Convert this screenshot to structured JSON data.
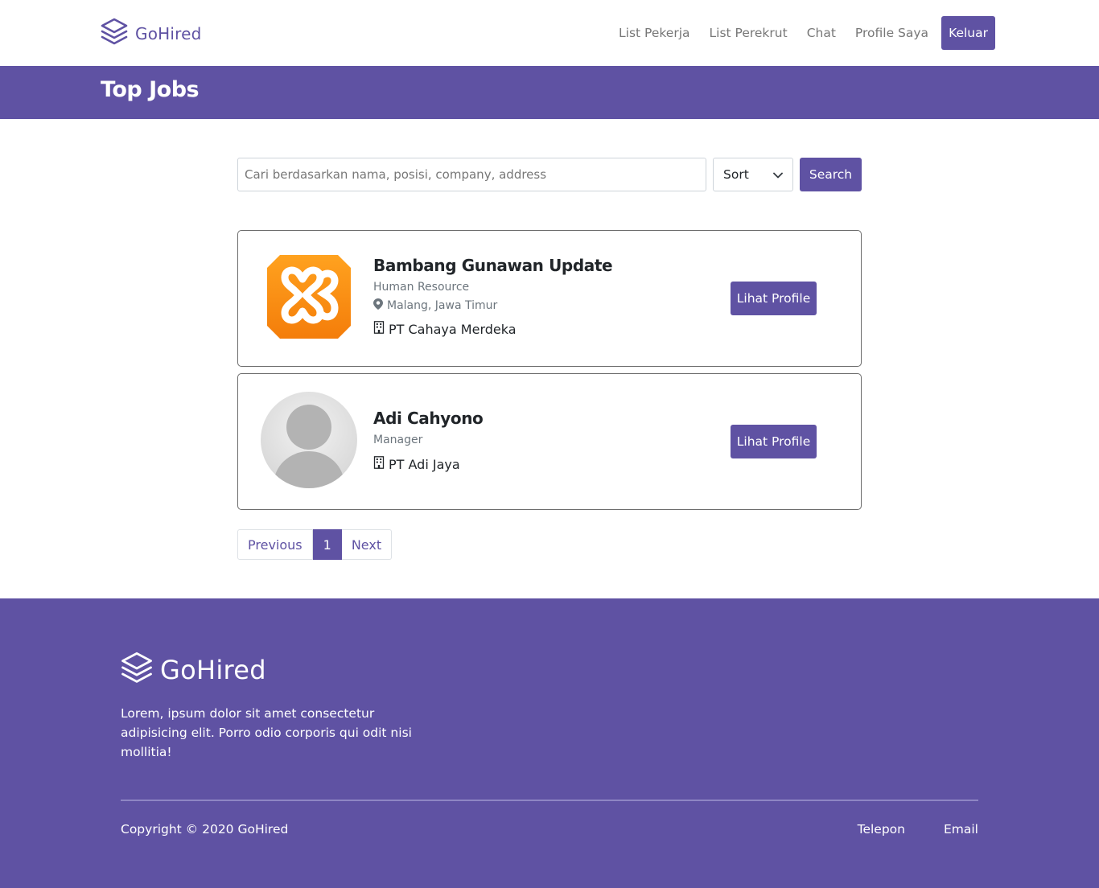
{
  "navbar": {
    "brand": "GoHired",
    "links": [
      "List Pekerja",
      "List Perekrut",
      "Chat",
      "Profile Saya"
    ],
    "logout_label": "Keluar"
  },
  "header": {
    "title": "Top Jobs"
  },
  "search": {
    "placeholder": "Cari berdasarkan nama, posisi, company, address",
    "sort_label": "Sort",
    "button_label": "Search"
  },
  "results": [
    {
      "name": "Bambang Gunawan Update",
      "position": "Human Resource",
      "location": "Malang, Jawa Timur",
      "company": "PT Cahaya Merdeka",
      "avatar_icon": "xampp-logo-icon",
      "button_label": "Lihat Profile"
    },
    {
      "name": "Adi Cahyono",
      "position": "Manager",
      "company": "PT Adi Jaya",
      "avatar_icon": "default-user-avatar-icon",
      "button_label": "Lihat Profile"
    }
  ],
  "pagination": {
    "prev_label": "Previous",
    "current_page": "1",
    "next_label": "Next"
  },
  "footer": {
    "brand": "GoHired",
    "description": "Lorem, ipsum dolor sit amet consectetur adipisicing elit. Porro odio corporis qui odit nisi mollitia!",
    "copyright": "Copyright © 2020 GoHired",
    "links": [
      "Telepon",
      "Email"
    ]
  },
  "colors": {
    "primary": "#5f52a3",
    "muted_text": "#6c757d",
    "nav_text": "#777777"
  }
}
